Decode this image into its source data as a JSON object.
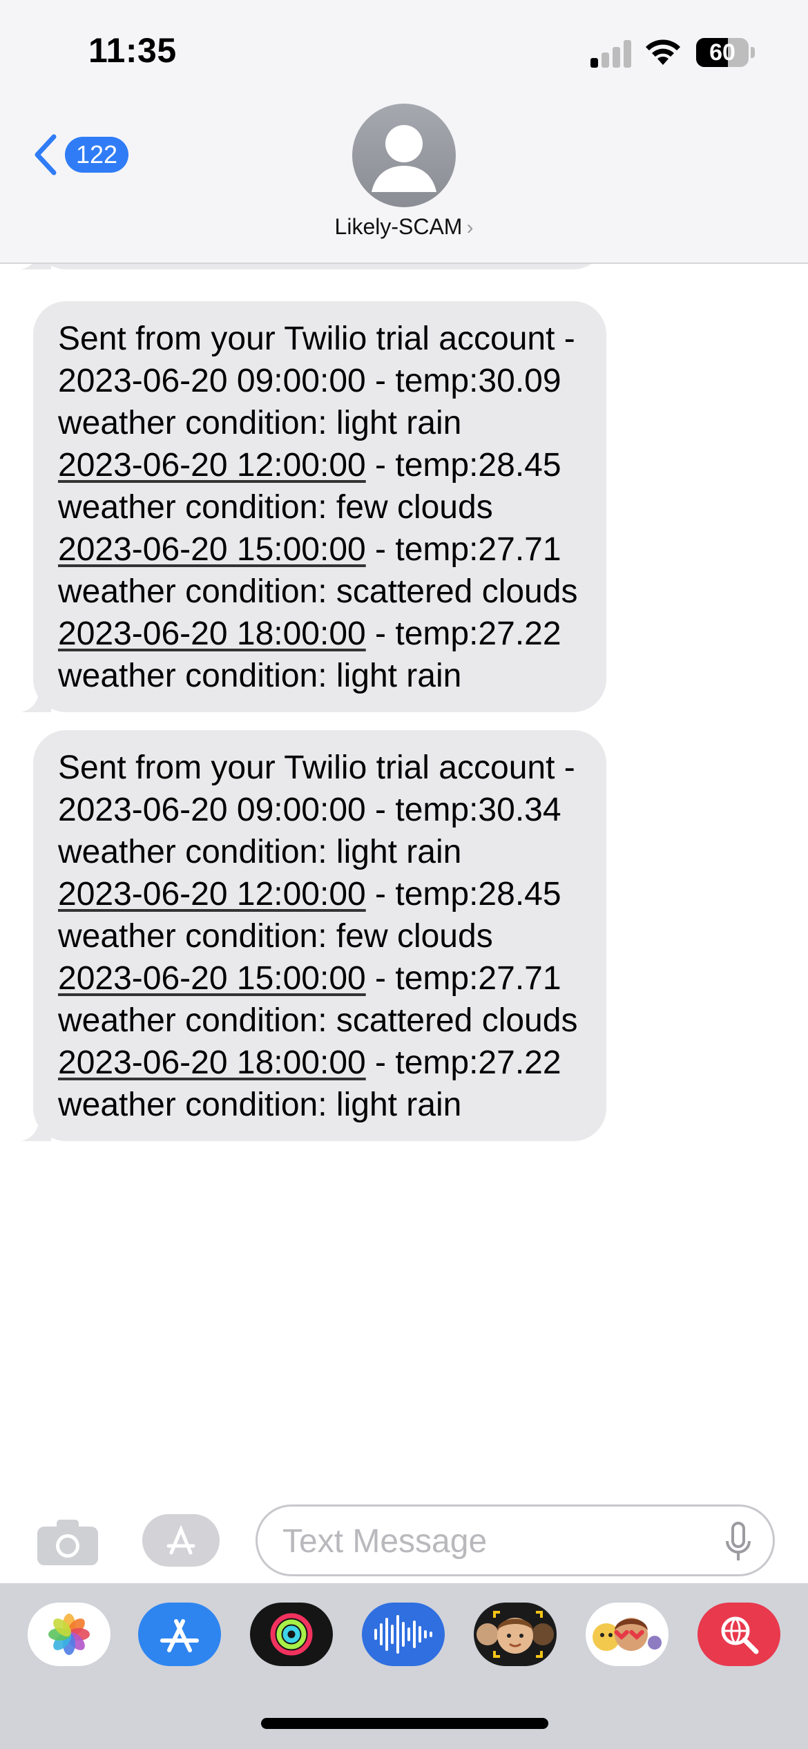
{
  "status_bar": {
    "time": "11:35",
    "battery_percent": "60",
    "battery_level": 0.6,
    "signal_bars_active": 1,
    "signal_bars_total": 4
  },
  "header": {
    "back_badge_count": "122",
    "contact_name": "Likely-SCAM",
    "contact_chevron": "›"
  },
  "messages": [
    {
      "intro": "Sent from your Twilio trial account - ",
      "entries": [
        {
          "datetime": "2023-06-20 09:00:00",
          "text": " - temp:30.09 weather condition: light rain"
        },
        {
          "datetime": "2023-06-20 12:00:00",
          "text": " - temp:28.45 weather condition: few clouds"
        },
        {
          "datetime": "2023-06-20 15:00:00",
          "text": " - temp:27.71 weather condition: scattered clouds"
        },
        {
          "datetime": "2023-06-20 18:00:00",
          "text": " - temp:27.22 weather condition: light rain"
        }
      ]
    },
    {
      "intro": "Sent from your Twilio trial account - ",
      "entries": [
        {
          "datetime": "2023-06-20 09:00:00",
          "text": " - temp:30.34 weather condition: light rain"
        },
        {
          "datetime": "2023-06-20 12:00:00",
          "text": " - temp:28.45 weather condition: few clouds"
        },
        {
          "datetime": "2023-06-20 15:00:00",
          "text": " - temp:27.71 weather condition: scattered clouds"
        },
        {
          "datetime": "2023-06-20 18:00:00",
          "text": " - temp:27.22 weather condition: light rain"
        }
      ]
    }
  ],
  "composer": {
    "placeholder": "Text Message",
    "value": ""
  },
  "app_drawer": [
    {
      "name": "photos-app-icon"
    },
    {
      "name": "app-store-app-icon"
    },
    {
      "name": "fitness-app-icon"
    },
    {
      "name": "audio-message-app-icon"
    },
    {
      "name": "memoji-app-icon"
    },
    {
      "name": "memoji-stickers-app-icon"
    },
    {
      "name": "images-search-app-icon"
    }
  ],
  "colors": {
    "accent": "#2f7cf6",
    "bubble_incoming": "#e9e9eb",
    "header_bg": "#f5f5f7",
    "drawer_bg": "#d1d3d9"
  }
}
